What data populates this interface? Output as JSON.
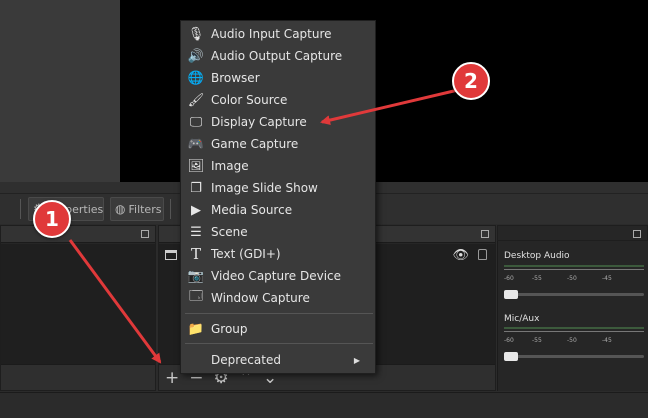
{
  "toolbar": {
    "properties_label": "Properties",
    "filters_label": "Filters"
  },
  "sources": {
    "row_icon": "window-icon"
  },
  "mixer": {
    "channels": [
      {
        "name": "Desktop Audio",
        "ticks": [
          "-60",
          "-55",
          "-50",
          "-45"
        ]
      },
      {
        "name": "Mic/Aux",
        "ticks": [
          "-60",
          "-55",
          "-50",
          "-45"
        ]
      }
    ]
  },
  "context_menu": {
    "items": [
      {
        "label": "Audio Input Capture",
        "icon": "microphone-icon"
      },
      {
        "label": "Audio Output Capture",
        "icon": "speaker-icon"
      },
      {
        "label": "Browser",
        "icon": "globe-icon"
      },
      {
        "label": "Color Source",
        "icon": "brush-icon"
      },
      {
        "label": "Display Capture",
        "icon": "monitor-icon"
      },
      {
        "label": "Game Capture",
        "icon": "gamepad-icon"
      },
      {
        "label": "Image",
        "icon": "image-icon"
      },
      {
        "label": "Image Slide Show",
        "icon": "slideshow-icon"
      },
      {
        "label": "Media Source",
        "icon": "play-icon"
      },
      {
        "label": "Scene",
        "icon": "list-icon"
      },
      {
        "label": "Text (GDI+)",
        "icon": "text-icon"
      },
      {
        "label": "Video Capture Device",
        "icon": "camera-icon"
      },
      {
        "label": "Window Capture",
        "icon": "window-icon"
      }
    ],
    "group": {
      "label": "Group",
      "icon": "folder-icon"
    },
    "deprecated": {
      "label": "Deprecated"
    }
  },
  "annotations": {
    "badge_1": "1",
    "badge_2": "2",
    "color": "#e0393a"
  }
}
